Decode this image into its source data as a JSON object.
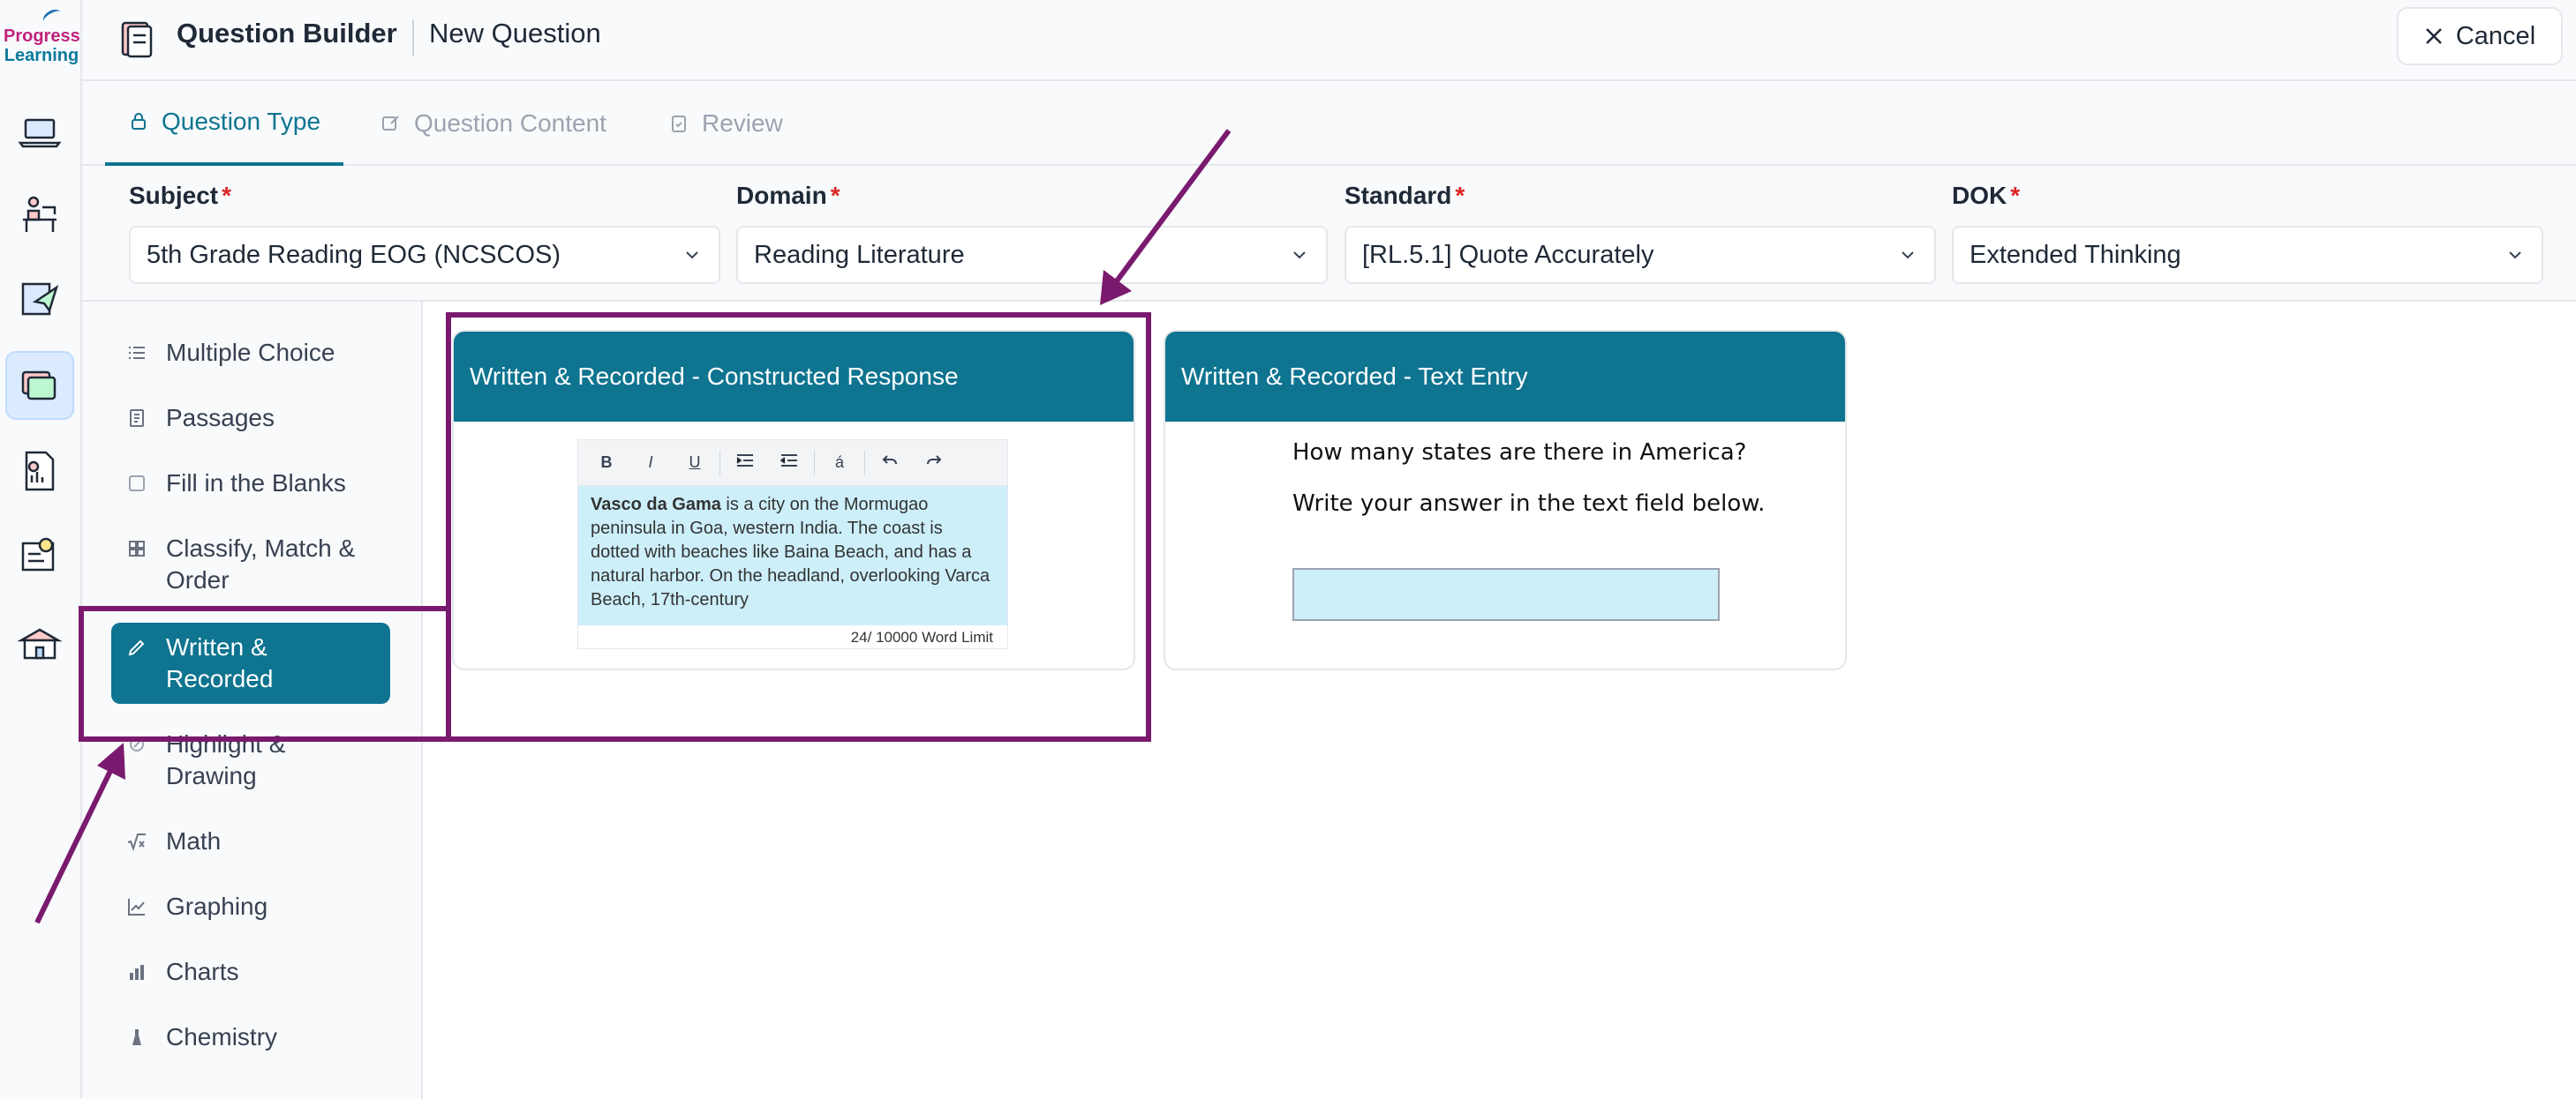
{
  "logo": {
    "line1": "Progress",
    "line2": "Learning"
  },
  "header": {
    "title": "Question Builder",
    "subtitle": "New Question",
    "cancel_label": "Cancel"
  },
  "tabs": [
    {
      "label": "Question Type",
      "active": true
    },
    {
      "label": "Question Content",
      "active": false
    },
    {
      "label": "Review",
      "active": false
    }
  ],
  "filters": {
    "subject": {
      "label": "Subject",
      "value": "5th Grade Reading EOG (NCSCOS)"
    },
    "domain": {
      "label": "Domain",
      "value": "Reading Literature"
    },
    "standard": {
      "label": "Standard",
      "value": "[RL.5.1] Quote Accurately"
    },
    "dok": {
      "label": "DOK",
      "value": "Extended Thinking"
    },
    "required_mark": "*"
  },
  "question_types": [
    {
      "label": "Multiple Choice",
      "icon": "list-icon"
    },
    {
      "label": "Passages",
      "icon": "document-icon"
    },
    {
      "label": "Fill in the Blanks",
      "icon": "blank-square-icon"
    },
    {
      "label": "Classify, Match & Order",
      "icon": "grid-icon"
    },
    {
      "label": "Written & Recorded",
      "icon": "pencil-icon",
      "active": true
    },
    {
      "label": "Highlight & Drawing",
      "icon": "highlight-icon"
    },
    {
      "label": "Math",
      "icon": "sqrt-icon"
    },
    {
      "label": "Graphing",
      "icon": "line-chart-icon"
    },
    {
      "label": "Charts",
      "icon": "bar-chart-icon"
    },
    {
      "label": "Chemistry",
      "icon": "flask-icon"
    }
  ],
  "cards": {
    "constructed": {
      "title": "Written & Recorded - Constructed Response",
      "editor_bold": "Vasco da Gama",
      "editor_text": " is a city on the Mormugao peninsula in Goa, western India. The coast is dotted with beaches like Baina Beach, and has a natural harbor. On the headland, overlooking Varca Beach, 17th-century",
      "word_count": "24",
      "word_limit": " / 10000 Word Limit",
      "toolbar": [
        "B",
        "I",
        "U",
        "á"
      ]
    },
    "text_entry": {
      "title": "Written & Recorded - Text Entry",
      "question": "How many states are there in America?",
      "instruction": "Write your answer in the text field below."
    }
  },
  "colors": {
    "brand": "#0e7490",
    "annotation": "#7a1a6e",
    "required": "#dc2626"
  }
}
